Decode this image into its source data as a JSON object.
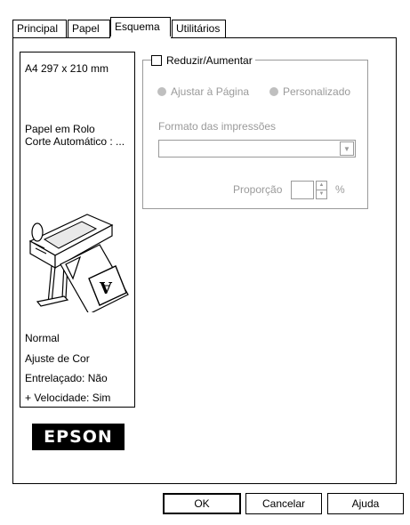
{
  "tabs": [
    "Principal",
    "Papel",
    "Esquema",
    "Utilitários"
  ],
  "preview": {
    "paper_size": "A4 297 x 210 mm",
    "paper_source_line1": "Papel em Rolo",
    "paper_source_line2": "Corte Automático : ...",
    "mode": "Normal",
    "color_adjust": "Ajuste de Cor",
    "interleave": "Entrelaçado: Não",
    "speed": "+ Velocidade: Sim",
    "logo": "EPSON",
    "printer_icon": "large-format-printer-icon"
  },
  "reduce_enlarge": {
    "checkbox_label": "Reduzir/Aumentar",
    "checked": false,
    "fit_page_label": "Ajustar à Página",
    "custom_label": "Personalizado",
    "output_format_label": "Formato das impressões",
    "output_format_value": "",
    "proportion_label": "Proporção",
    "proportion_value": "",
    "percent_symbol": "%"
  },
  "buttons": {
    "ok": "OK",
    "cancel": "Cancelar",
    "help": "Ajuda"
  }
}
